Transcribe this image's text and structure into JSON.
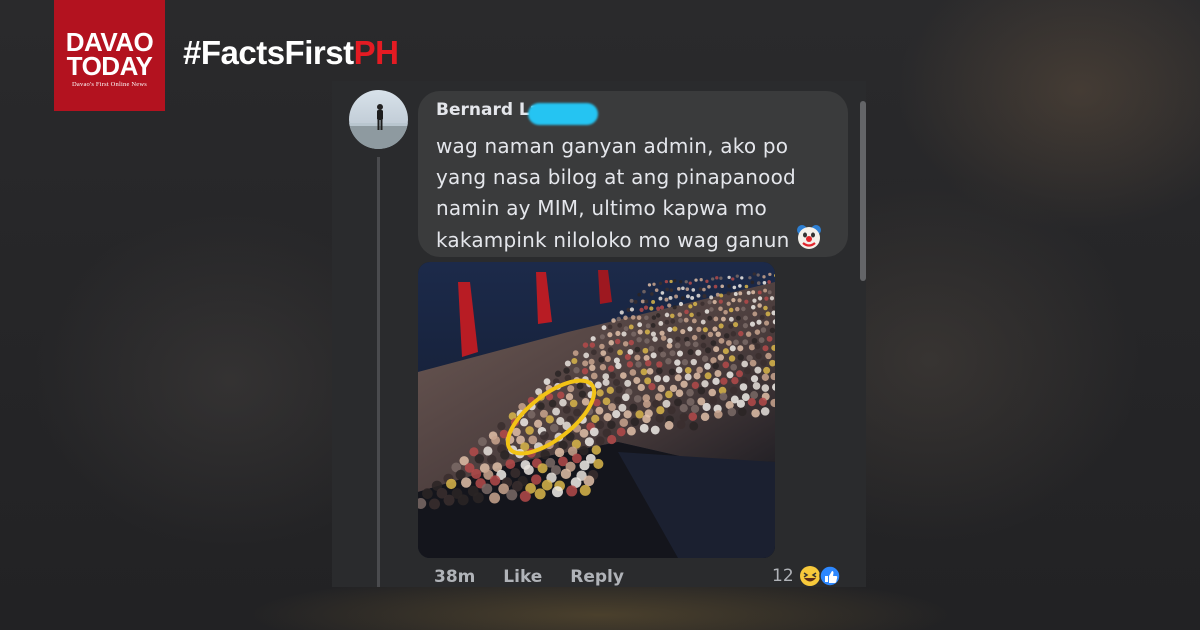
{
  "brand": {
    "logo_line1": "DAVAO",
    "logo_line2": "TODAY",
    "tagline": "Davao's First Online News",
    "hashtag_main": "#FactsFirst",
    "hashtag_accent": "PH",
    "accent_color": "#e41b23",
    "logo_bg": "#b3121f"
  },
  "comment": {
    "author": "Bernard La",
    "text": "wag naman ganyan admin, ako po yang nasa bilog at ang pinapanood namin ay MIM, ultimo kapwa mo kakampink niloloko mo wag ganun",
    "emoji": "clown-face",
    "time": "38m",
    "like_label": "Like",
    "reply_label": "Reply",
    "reaction_count": "12",
    "reactions": [
      "haha",
      "like"
    ]
  }
}
